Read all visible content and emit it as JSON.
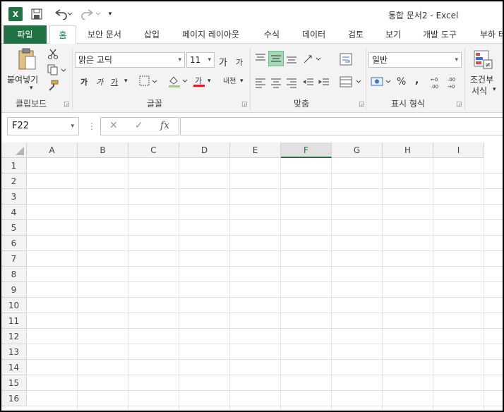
{
  "titlebar": {
    "app_icon": "X",
    "title": "통합 문서2 - Excel",
    "save_icon": "save-icon",
    "undo_icon": "undo-icon",
    "redo_icon": "redo-icon"
  },
  "tabs": [
    {
      "label": "파일"
    },
    {
      "label": "홈"
    },
    {
      "label": "보안 문서"
    },
    {
      "label": "삽입"
    },
    {
      "label": "페이지 레이아웃"
    },
    {
      "label": "수식"
    },
    {
      "label": "데이터"
    },
    {
      "label": "검토"
    },
    {
      "label": "보기"
    },
    {
      "label": "개발 도구"
    },
    {
      "label": "부하 테"
    }
  ],
  "ribbon": {
    "clipboard": {
      "paste_label": "붙여넣기",
      "group_label": "클립보드"
    },
    "font": {
      "font_name": "맑은 고딕",
      "font_size": "11",
      "grow_label": "가",
      "shrink_label": "가",
      "bold_label": "가",
      "italic_label": "가",
      "underline_label": "가",
      "font_color_label": "가",
      "phonetic_label": "내천",
      "group_label": "글꼴"
    },
    "alignment": {
      "group_label": "맞춤"
    },
    "number": {
      "format": "일반",
      "percent": "%",
      "comma": ",",
      "group_label": "표시 형식"
    },
    "styles": {
      "cond_format_line1": "조건부",
      "cond_format_line2": "서식"
    }
  },
  "formula_bar": {
    "name_box": "F22",
    "cancel": "✕",
    "enter": "✓",
    "fx": "fx",
    "value": ""
  },
  "sheet": {
    "columns": [
      "A",
      "B",
      "C",
      "D",
      "E",
      "F",
      "G",
      "H",
      "I"
    ],
    "rows": [
      "1",
      "2",
      "3",
      "4",
      "5",
      "6",
      "7",
      "8",
      "9",
      "10",
      "11",
      "12",
      "13",
      "14",
      "15",
      "16"
    ],
    "active_column": "F",
    "accent_color": "#217346"
  }
}
